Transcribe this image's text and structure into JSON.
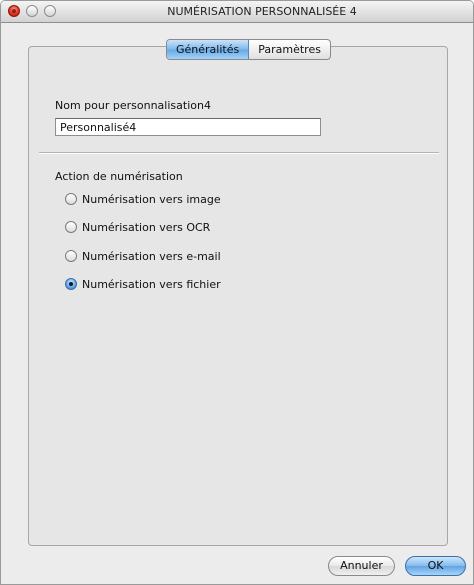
{
  "window": {
    "title": "NUMÉRISATION PERSONNALISÉE 4"
  },
  "tabs": [
    {
      "label": "Généralités",
      "active": true
    },
    {
      "label": "Paramètres",
      "active": false
    }
  ],
  "name_field": {
    "label": "Nom pour personnalisation4",
    "value": "Personnalisé4"
  },
  "action": {
    "label": "Action de numérisation",
    "options": [
      {
        "label": "Numérisation vers image",
        "selected": false
      },
      {
        "label": "Numérisation vers OCR",
        "selected": false
      },
      {
        "label": "Numérisation vers e-mail",
        "selected": false
      },
      {
        "label": "Numérisation vers fichier",
        "selected": true
      }
    ]
  },
  "buttons": {
    "cancel": "Annuler",
    "ok": "OK"
  },
  "colors": {
    "accent": "#6aa8e6",
    "window_bg": "#ececec",
    "close_red": "#e0331d"
  }
}
